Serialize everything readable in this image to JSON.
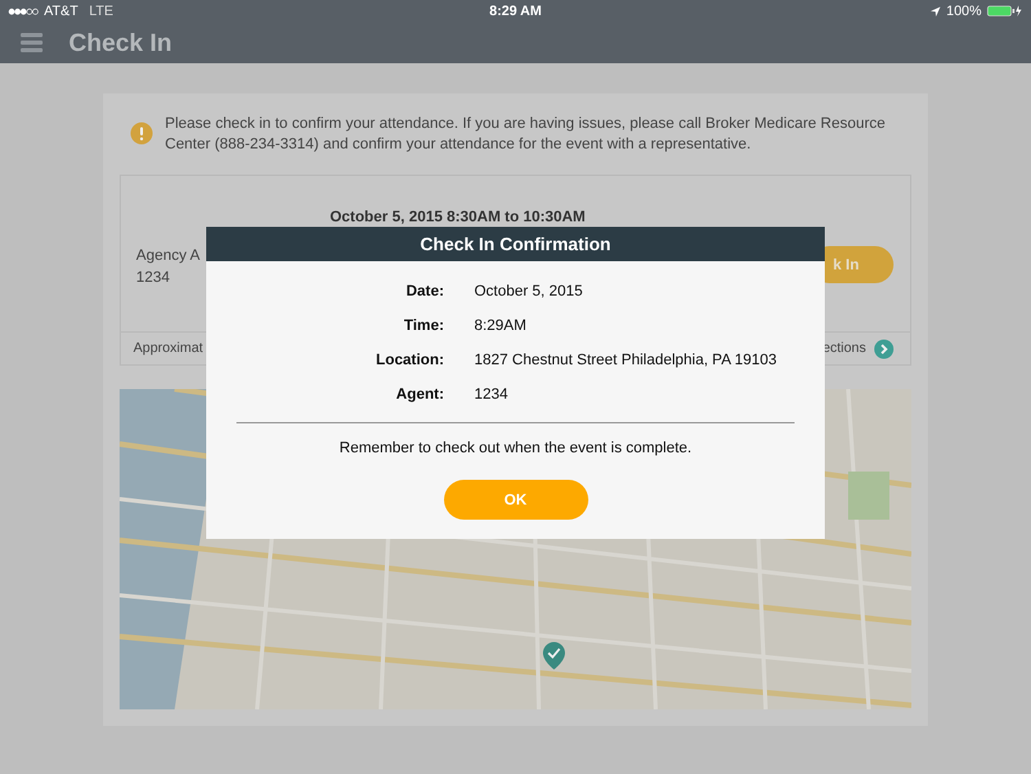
{
  "status_bar": {
    "carrier": "AT&T",
    "network": "LTE",
    "time": "8:29 AM",
    "battery": "100%"
  },
  "header": {
    "title": "Check In"
  },
  "notice": {
    "text": "Please check in to confirm your attendance. If you are having issues, please call Broker Medicare Resource Center (888-234-3314) and confirm your attendance for the event with a representative."
  },
  "event": {
    "datetime": "October 5, 2015 8:30AM to 10:30AM",
    "agency": "Agency A",
    "agent": "1234",
    "check_in_button": "k In",
    "approximate_text": "Approximat",
    "directions_link": "ections"
  },
  "dialog": {
    "title": "Check In Confirmation",
    "rows": [
      {
        "label": "Date:",
        "value": "October 5, 2015"
      },
      {
        "label": "Time:",
        "value": "8:29AM"
      },
      {
        "label": "Location:",
        "value": "1827 Chestnut Street Philadelphia, PA 19103"
      },
      {
        "label": "Agent:",
        "value": "1234"
      }
    ],
    "note": "Remember to check out when the event is complete.",
    "button": "OK"
  }
}
